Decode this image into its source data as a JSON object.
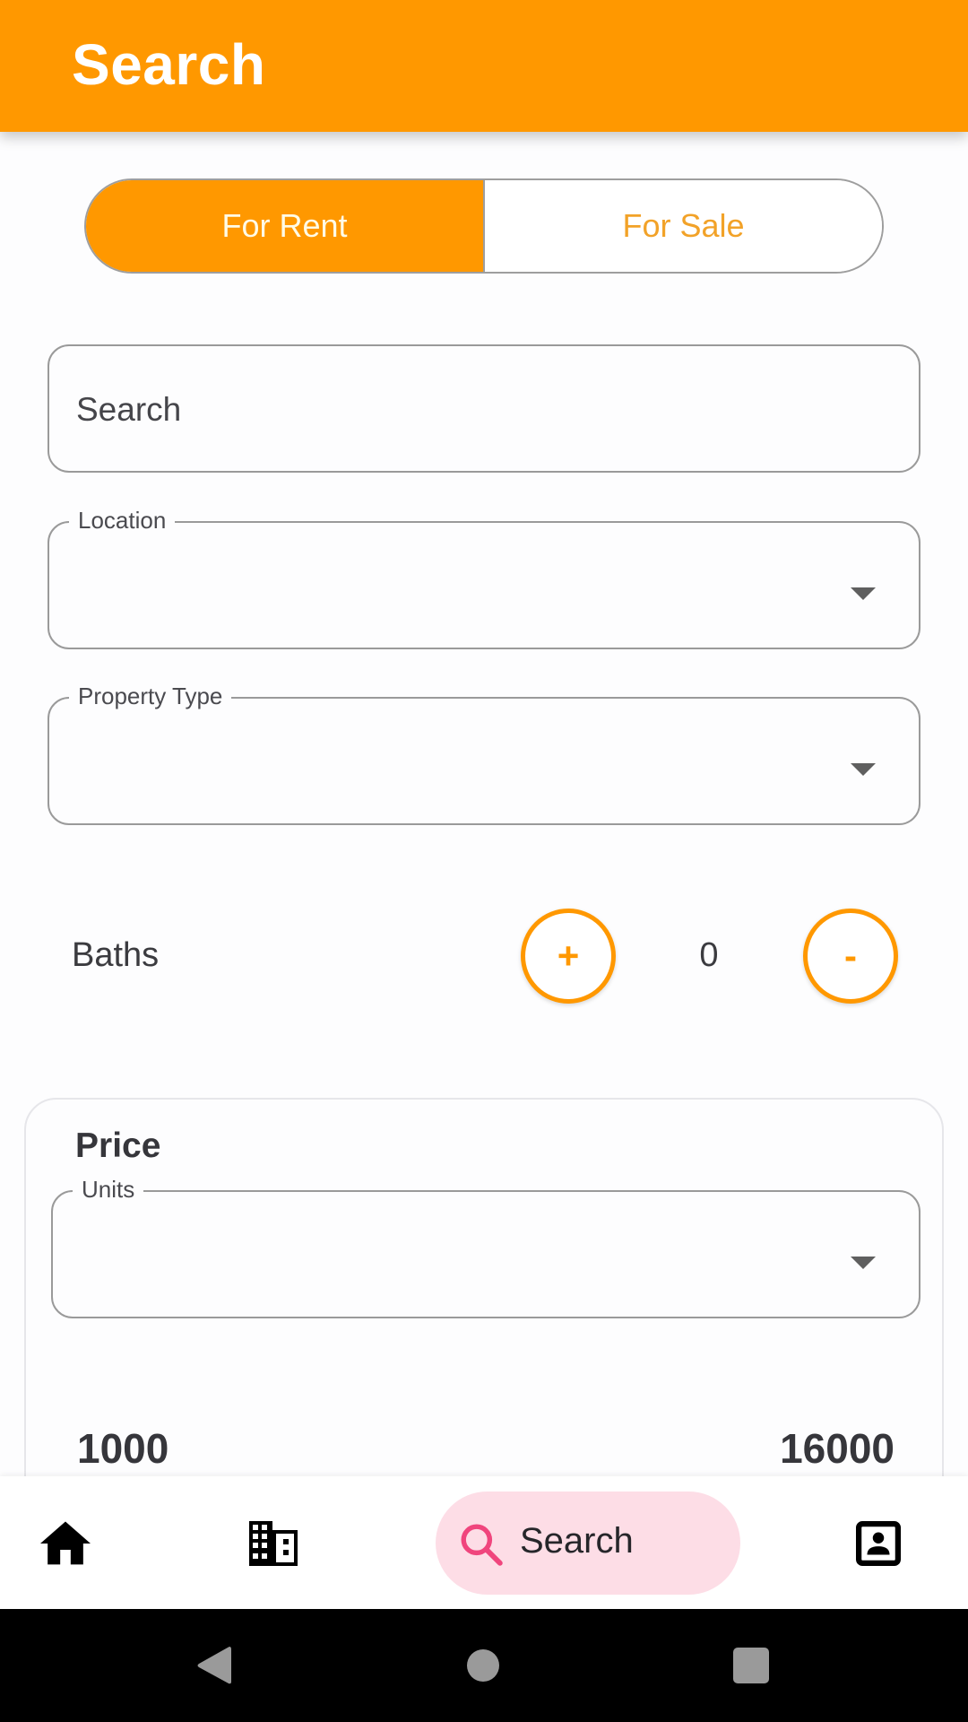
{
  "app_bar": {
    "title": "Search"
  },
  "listing_toggle": {
    "options": [
      {
        "label": "For Rent",
        "selected": true
      },
      {
        "label": "For Sale",
        "selected": false
      }
    ]
  },
  "search_field": {
    "placeholder": "Search",
    "value": ""
  },
  "location_field": {
    "label": "Location",
    "value": ""
  },
  "property_type_field": {
    "label": "Property Type",
    "value": ""
  },
  "baths": {
    "label": "Baths",
    "value": "0",
    "increment_label": "+",
    "decrement_label": "-"
  },
  "price": {
    "title": "Price",
    "units_field": {
      "label": "Units",
      "value": ""
    },
    "range_min": "1000",
    "range_max": "16000"
  },
  "bottom_nav": {
    "items": [
      {
        "name": "home",
        "icon": "home-icon",
        "label": ""
      },
      {
        "name": "properties",
        "icon": "building-icon",
        "label": ""
      },
      {
        "name": "search",
        "icon": "search-icon",
        "label": "Search",
        "active": true
      },
      {
        "name": "profile",
        "icon": "contact-portrait-icon",
        "label": ""
      }
    ]
  },
  "system_nav": {
    "buttons": [
      "back",
      "home",
      "recents"
    ]
  },
  "colors": {
    "primary": "#FF9800",
    "nav_active_bg": "#FDDDE6",
    "nav_active_icon": "#F0457D",
    "inactive_toggle_text": "#F2A228"
  }
}
